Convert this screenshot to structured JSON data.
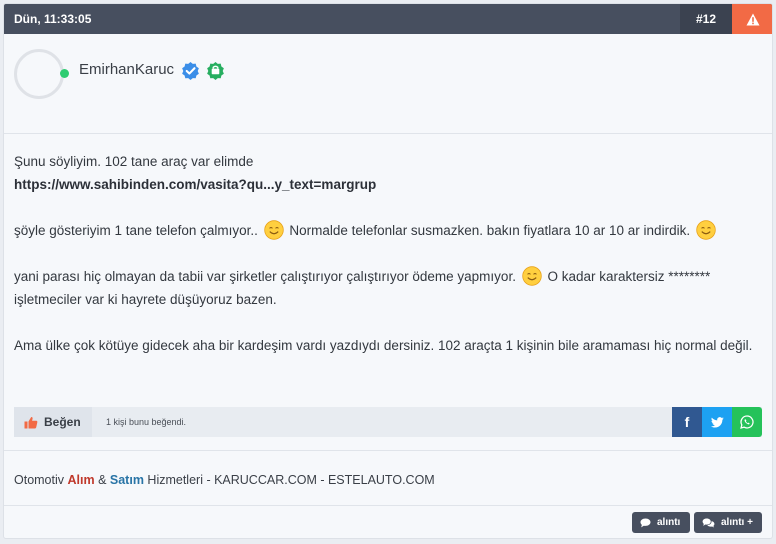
{
  "header": {
    "timestamp": "Dün, 11:33:05",
    "post_number": "#12",
    "report_icon": "warning-icon"
  },
  "author": {
    "username": "EmirhanKaruc",
    "status": "online",
    "badges": [
      "verified-badge-icon",
      "shop-badge-icon"
    ]
  },
  "message": {
    "line1": "Şunu söyliyim. 102 tane araç var elimde",
    "link": "https://www.sahibinden.com/vasita?qu...y_text=margrup",
    "para2_a": "şöyle gösteriyim 1 tane telefon çalmıyor.. ",
    "para2_b": " Normalde telefonlar susmazken. bakın fiyatlara 10 ar 10 ar indirdik. ",
    "para3_a": "yani parası hiç olmayan da tabii var şirketler çalıştırıyor çalıştırıyor ödeme yapmıyor. ",
    "para3_b": " O kadar karaktersiz ******** işletmeciler var ki hayrete düşüyoruz bazen.",
    "para4": "Ama ülke çok kötüye gidecek aha bir kardeşim vardı yazdıydı dersiniz. 102 araçta 1 kişinin bile aramaması hiç normal değil.",
    "emoji": "smiling-face-emoji"
  },
  "reactions": {
    "like_label": "Beğen",
    "like_count_text": "1 kişi bunu beğendi.",
    "share_facebook": "f",
    "share_twitter": "twitter-icon",
    "share_whatsapp": "whatsapp-icon"
  },
  "signature": {
    "prefix": "Otomotiv ",
    "red_word": "Alım",
    "amp": " & ",
    "blue_word": "Satım",
    "suffix": " Hizmetleri - KARUCCAR.COM - ESTELAUTO.COM"
  },
  "actions": {
    "quote_label": "alıntı",
    "multi_quote_label": "alıntı +"
  },
  "colors": {
    "header_bg": "#474f5f",
    "report_bg": "#f26a45",
    "online": "#2ecc71",
    "facebook": "#305891",
    "twitter": "#1da1f2",
    "whatsapp": "#25c25a",
    "signature_red": "#c0392b",
    "signature_blue": "#2874a6"
  }
}
